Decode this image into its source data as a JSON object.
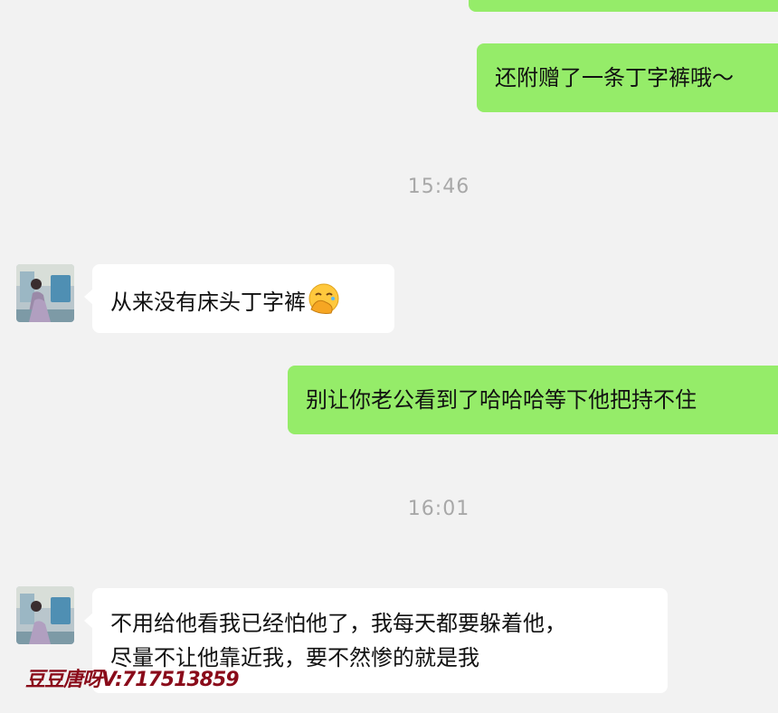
{
  "messages": {
    "m1": {
      "text": "还附赠了一条丁字裤哦～",
      "side": "outgoing"
    },
    "t1": {
      "text": "15:46"
    },
    "m2": {
      "text": "从来没有床头丁字裤",
      "side": "incoming",
      "emoji": "face-with-hand-over-mouth"
    },
    "m3": {
      "text": "别让你老公看到了哈哈哈等下他把持不住",
      "side": "outgoing"
    },
    "t2": {
      "text": "16:01"
    },
    "m4": {
      "line1": "不用给他看我已经怕他了，我每天都要躲着他，",
      "line2": "尽量不让他靠近我，要不然惨的就是我",
      "side": "incoming"
    }
  },
  "watermark": "豆豆唐呀V:717513859",
  "colors": {
    "outgoing_bubble": "#95ec69",
    "incoming_bubble": "#ffffff",
    "background": "#f2f2f2",
    "timestamp": "#a8a8a8",
    "watermark": "#8a0b1a"
  }
}
